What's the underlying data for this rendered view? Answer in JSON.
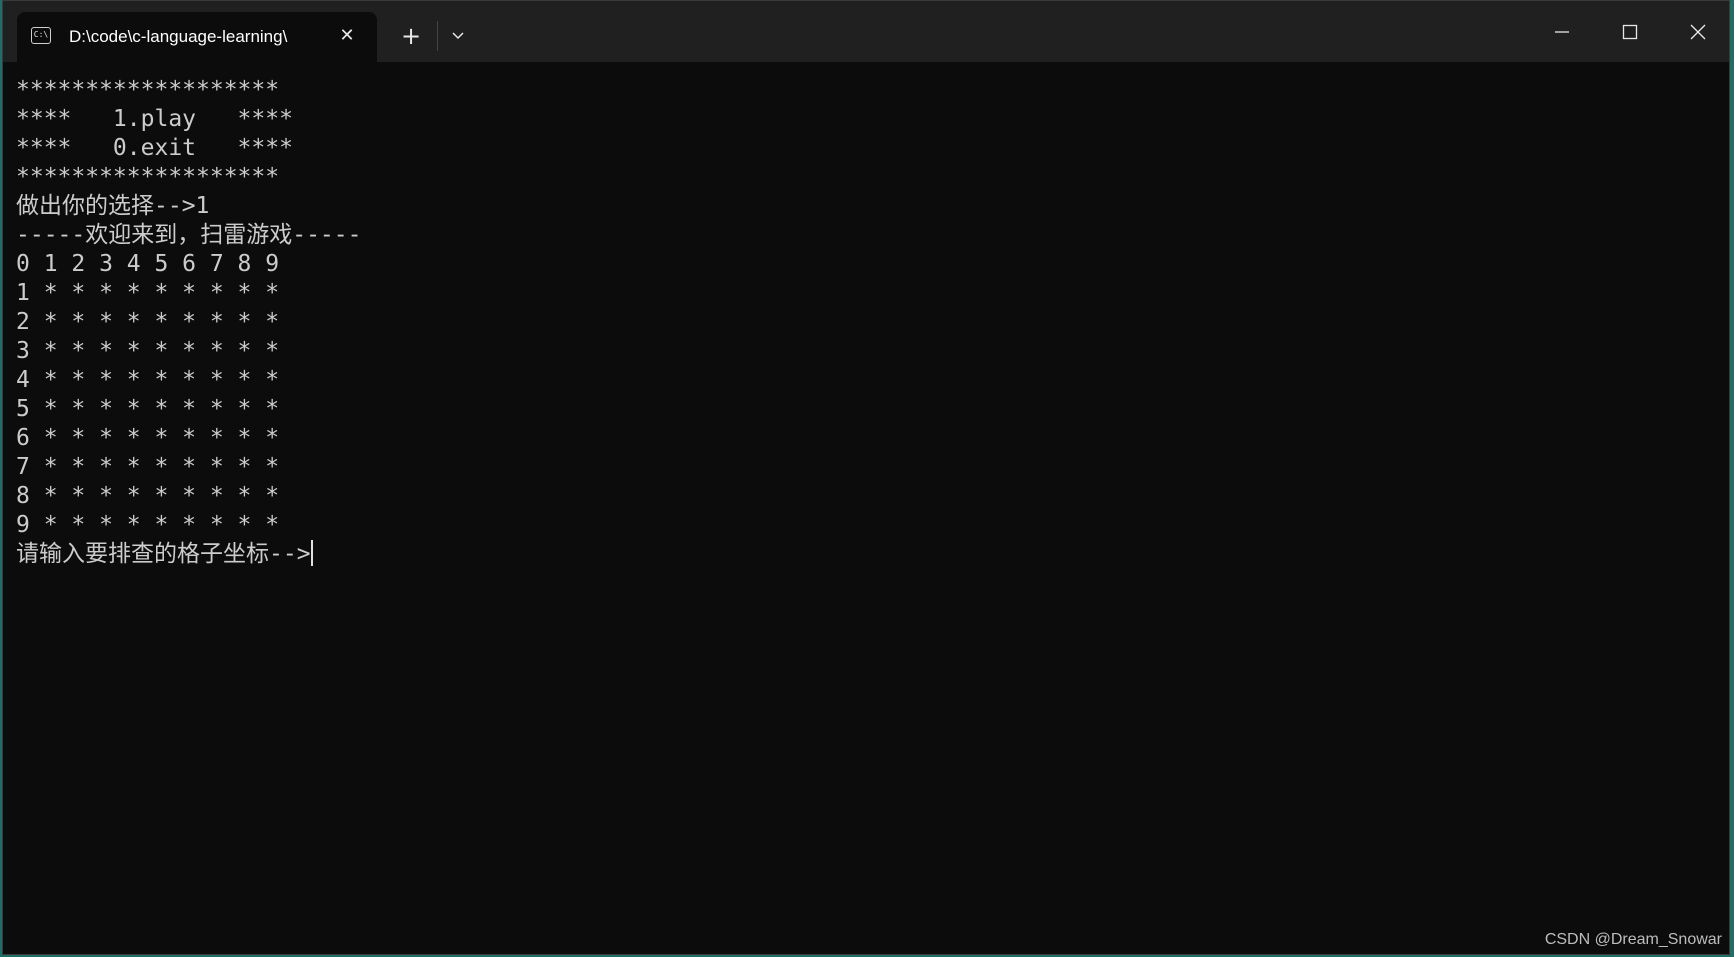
{
  "window": {
    "tab_title": "D:\\code\\c-language-learning\\",
    "tab_icon": "console-icon",
    "icons": {
      "close_tab": "close-icon",
      "new_tab": "plus-icon",
      "dropdown": "chevron-down-icon",
      "minimize": "minimize-icon",
      "maximize": "maximize-icon",
      "close_window": "close-icon"
    }
  },
  "console": {
    "lines": [
      "*******************",
      "****   1.play   ****",
      "****   0.exit   ****",
      "*******************",
      "做出你的选择-->1",
      "-----欢迎来到，扫雷游戏-----",
      "0 1 2 3 4 5 6 7 8 9",
      "1 * * * * * * * * *",
      "2 * * * * * * * * *",
      "3 * * * * * * * * *",
      "4 * * * * * * * * *",
      "5 * * * * * * * * *",
      "6 * * * * * * * * *",
      "7 * * * * * * * * *",
      "8 * * * * * * * * *",
      "9 * * * * * * * * *"
    ],
    "prompt": "请输入要排查的格子坐标-->"
  },
  "watermark": "CSDN @Dream_Snowar"
}
